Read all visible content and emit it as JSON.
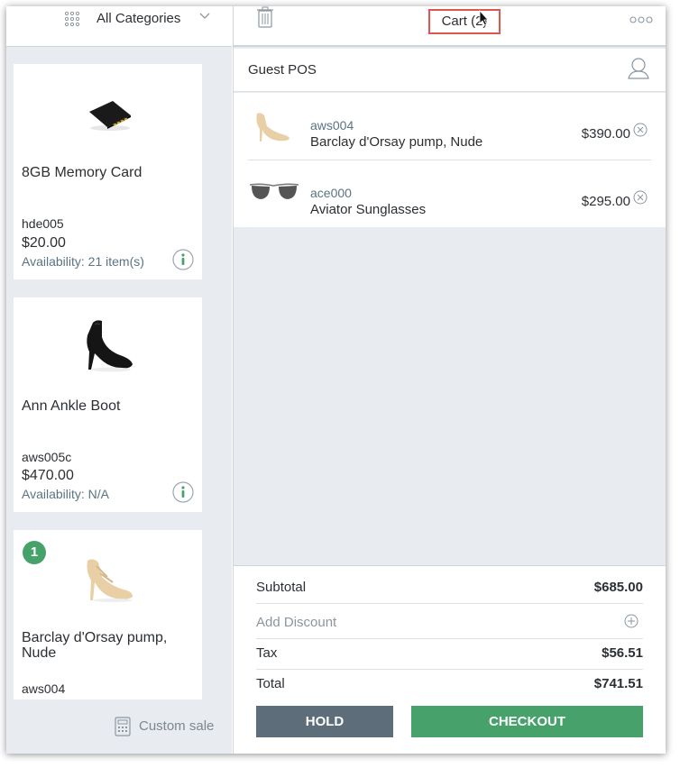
{
  "category_bar": {
    "label": "All Categories"
  },
  "products": [
    {
      "name": "8GB Memory Card",
      "sku": "hde005",
      "price": "$20.00",
      "availability": "Availability: 21 item(s)"
    },
    {
      "name": "Ann Ankle Boot",
      "sku": "aws005c",
      "price": "$470.00",
      "availability": "Availability: N/A"
    },
    {
      "name": "Barclay d'Orsay pump, Nude",
      "sku": "aws004",
      "badge": "1"
    }
  ],
  "custom_sale": {
    "label": "Custom sale"
  },
  "cart": {
    "title": "Cart (2)",
    "customer": "Guest POS",
    "items": [
      {
        "sku": "aws004",
        "name": "Barclay d'Orsay pump, Nude",
        "price": "$390.00"
      },
      {
        "sku": "ace000",
        "name": "Aviator Sunglasses",
        "price": "$295.00"
      }
    ]
  },
  "summary": {
    "subtotal_label": "Subtotal",
    "subtotal": "$685.00",
    "discount_label": "Add Discount",
    "tax_label": "Tax",
    "tax": "$56.51",
    "total_label": "Total",
    "total": "$741.51"
  },
  "actions": {
    "hold": "HOLD",
    "checkout": "CHECKOUT"
  },
  "colors": {
    "checkout": "#46a26a",
    "hold": "#5e6d7a",
    "badge": "#46a26a",
    "highlight": "#e0564c"
  }
}
